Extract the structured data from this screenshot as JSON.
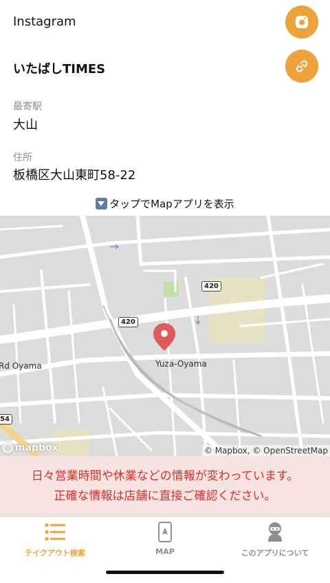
{
  "links": {
    "instagram_label": "Instagram",
    "website_label": "いたばしTIMES"
  },
  "station": {
    "caption": "最寄駅",
    "value": "大山"
  },
  "address": {
    "caption": "住所",
    "value": "板橋区大山東町58-22"
  },
  "map": {
    "hint": "タップでMapアプリを表示",
    "labels": {
      "street_left": "Rd Oyama",
      "street_main": "Yuza-Oyama",
      "route_420_a": "420",
      "route_420_b": "420",
      "route_edge": "54"
    },
    "logo": "mapbox",
    "attribution": "© Mapbox, © OpenStreetMap",
    "pin_color": "#E05A5A"
  },
  "notice": {
    "line1": "日々営業時間や休業などの情報が変わっています。",
    "line2": "正確な情報は店舗に直接ご確認ください。"
  },
  "tabs": [
    {
      "label": "テイクアウト検索",
      "icon": "list-icon",
      "active": true
    },
    {
      "label": "MAP",
      "icon": "map-phone-icon",
      "active": false
    },
    {
      "label": "このアプリについて",
      "icon": "ninja-icon",
      "active": false
    }
  ],
  "colors": {
    "accent": "#EDA23A",
    "notice_text": "#D93025",
    "notice_bg": "#F8E3E3"
  }
}
